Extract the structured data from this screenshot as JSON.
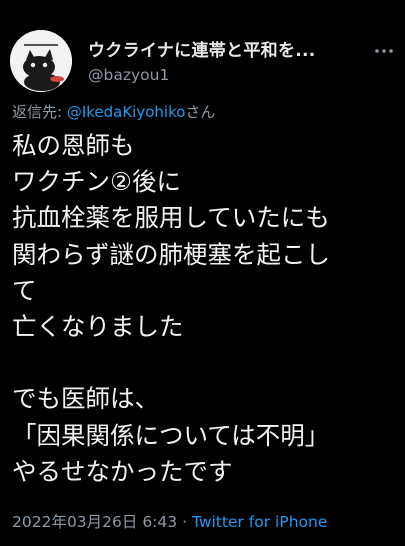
{
  "author": {
    "display_name": "ウクライナに連帯と平和を...",
    "handle": "@bazyou1",
    "avatar_icon": "cat-avatar-icon"
  },
  "reply": {
    "prefix": "返信先: ",
    "mention": "@IkedaKiyohiko",
    "suffix": "さん"
  },
  "body_lines": [
    "私の恩師も",
    "ワクチン②後に",
    "抗血栓薬を服用していたにも",
    "関わらず謎の肺梗塞を起こし",
    "て",
    "亡くなりました",
    "",
    "でも医師は、",
    "「因果関係については不明」",
    "やるせなかったです"
  ],
  "meta": {
    "timestamp": "2022年03月26日 6:43",
    "separator": " · ",
    "source": "Twitter for iPhone"
  },
  "colors": {
    "background": "#000000",
    "link": "#1d9bf0",
    "secondary_text": "#8b98a5"
  }
}
